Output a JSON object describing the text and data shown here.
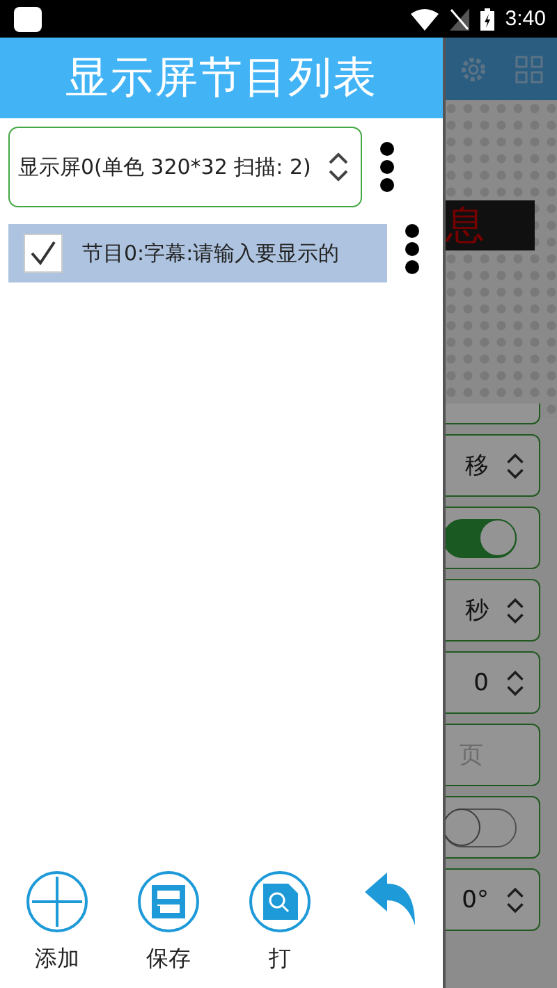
{
  "status_bar": {
    "time": "3:40"
  },
  "drawer": {
    "title": "显示屏节目列表",
    "display_select": {
      "value": "显示屏0(单色 320*32 扫描: 2)"
    },
    "programs": [
      {
        "label": "节目0:字幕:请输入要显示的",
        "checked": true,
        "selected": true
      }
    ],
    "buttons": [
      {
        "kind": "add",
        "label": "添加"
      },
      {
        "kind": "save",
        "label": "保存"
      },
      {
        "kind": "open",
        "label": "打"
      },
      {
        "kind": "back"
      }
    ]
  },
  "background": {
    "display_text": "息",
    "rows": [
      {
        "kind": "blank"
      },
      {
        "kind": "select",
        "value": "移"
      },
      {
        "kind": "toggle",
        "on": true
      },
      {
        "kind": "select",
        "value": "秒"
      },
      {
        "kind": "select",
        "value": "0"
      },
      {
        "kind": "field",
        "placeholder": "页"
      },
      {
        "kind": "toggle",
        "on": false
      },
      {
        "kind": "select",
        "value": "0°"
      }
    ]
  }
}
